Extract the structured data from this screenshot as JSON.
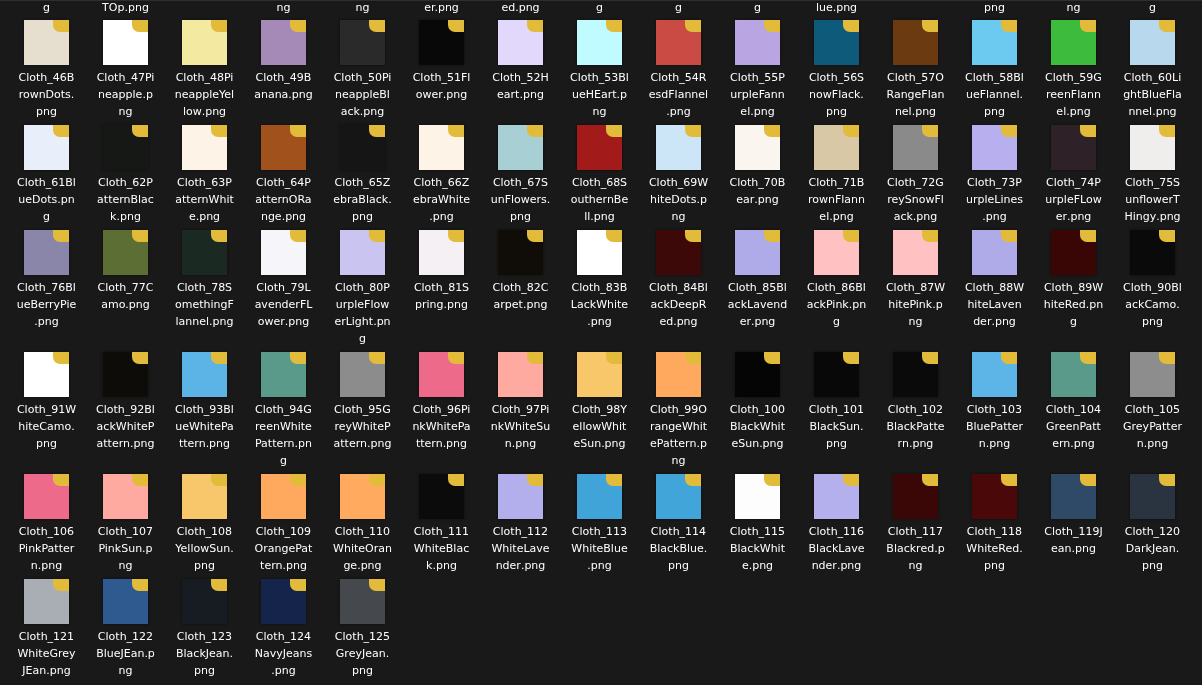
{
  "cut_off_labels": [
    {
      "kind": "text",
      "label": "g"
    },
    {
      "kind": "text",
      "label": "TOp.png"
    },
    {
      "kind": "gap"
    },
    {
      "kind": "text",
      "label": "ng"
    },
    {
      "kind": "text",
      "label": "ng"
    },
    {
      "kind": "text",
      "label": "er.png"
    },
    {
      "kind": "text",
      "label": "ed.png"
    },
    {
      "kind": "text",
      "label": "g"
    },
    {
      "kind": "text",
      "label": "g"
    },
    {
      "kind": "text",
      "label": "g"
    },
    {
      "kind": "text",
      "label": "lue.png"
    },
    {
      "kind": "gap"
    },
    {
      "kind": "text",
      "label": "png"
    },
    {
      "kind": "text",
      "label": "ng"
    },
    {
      "kind": "text",
      "label": "g"
    }
  ],
  "files": [
    {
      "name": "Cloth_46BrownDots.png",
      "color": "#e6dfd0"
    },
    {
      "name": "Cloth_47Pineapple.png",
      "color": "#ffffff"
    },
    {
      "name": "Cloth_48PineappleYellow.png",
      "color": "#f3e9a0"
    },
    {
      "name": "Cloth_49Banana.png",
      "color": "#a58ab8"
    },
    {
      "name": "Cloth_50PineappleBlack.png",
      "color": "#2a2a2a"
    },
    {
      "name": "Cloth_51Flower.png",
      "color": "#080808"
    },
    {
      "name": "Cloth_52Heart.png",
      "color": "#e2d8fb"
    },
    {
      "name": "Cloth_53BlueHEart.png",
      "color": "#bffbff"
    },
    {
      "name": "Cloth_54ResdFlannel.png",
      "color": "#c94b43"
    },
    {
      "name": "Cloth_55PurpleFannel.png",
      "color": "#b9a5e2"
    },
    {
      "name": "Cloth_56SnowFlack.png",
      "color": "#0d5a7a"
    },
    {
      "name": "Cloth_57ORangeFlannel.png",
      "color": "#6b3a10"
    },
    {
      "name": "Cloth_58BlueFlannel.png",
      "color": "#6ccaf0"
    },
    {
      "name": "Cloth_59GreenFlannel.png",
      "color": "#3dbb3d"
    },
    {
      "name": "Cloth_60LightBlueFlannel.png",
      "color": "#b8d8ee"
    },
    {
      "name": "Cloth_61BlueDots.png",
      "color": "#e8eefa"
    },
    {
      "name": "Cloth_62PatternBlack.png",
      "color": "#161816"
    },
    {
      "name": "Cloth_63PatternWhite.png",
      "color": "#fdf3e6"
    },
    {
      "name": "Cloth_64PatternORange.png",
      "color": "#a1521c"
    },
    {
      "name": "Cloth_65ZebraBlack.png",
      "color": "#151515"
    },
    {
      "name": "Cloth_66ZebraWhite.png",
      "color": "#fdf3e6"
    },
    {
      "name": "Cloth_67SunFlowers.png",
      "color": "#a8cfd4"
    },
    {
      "name": "Cloth_68SouthernBell.png",
      "color": "#a31a1a"
    },
    {
      "name": "Cloth_69WhiteDots.png",
      "color": "#cce6f7"
    },
    {
      "name": "Cloth_70Bear.png",
      "color": "#fbf5f0"
    },
    {
      "name": "Cloth_71BrownFlannel.png",
      "color": "#d8c8a6"
    },
    {
      "name": "Cloth_72GreySnowFlack.png",
      "color": "#8a8a8a"
    },
    {
      "name": "Cloth_73PurpleLines.png",
      "color": "#b8b0ee"
    },
    {
      "name": "Cloth_74PurpleFLower.png",
      "color": "#2e2228"
    },
    {
      "name": "Cloth_75SunflowerTHingy.png",
      "color": "#f0eeec"
    },
    {
      "name": "Cloth_76BlueBerryPie.png",
      "color": "#8a86aa"
    },
    {
      "name": "Cloth_77Camo.png",
      "color": "#5c6e34"
    },
    {
      "name": "Cloth_78SomethingFlannel.png",
      "color": "#1a2a22"
    },
    {
      "name": "Cloth_79LavenderFLower.png",
      "color": "#f5f5fa"
    },
    {
      "name": "Cloth_80PurpleFlowerLight.png",
      "color": "#c9c4f0"
    },
    {
      "name": "Cloth_81Spring.png",
      "color": "#f4f0f4"
    },
    {
      "name": "Cloth_82Carpet.png",
      "color": "#100c08"
    },
    {
      "name": "Cloth_83BLackWhite.png",
      "color": "#ffffff"
    },
    {
      "name": "Cloth_84BlackDeepRed.png",
      "color": "#3d0808"
    },
    {
      "name": "Cloth_85BlackLavender.png",
      "color": "#afaae8"
    },
    {
      "name": "Cloth_86BlackPink.png",
      "color": "#ffc1c1"
    },
    {
      "name": "Cloth_87WhitePink.png",
      "color": "#ffc1c1"
    },
    {
      "name": "Cloth_88WhiteLavender.png",
      "color": "#afaae8"
    },
    {
      "name": "Cloth_89WhiteRed.png",
      "color": "#3a0505"
    },
    {
      "name": "Cloth_90BlackCamo.png",
      "color": "#0a0a0a"
    },
    {
      "name": "Cloth_91WhiteCamo.png",
      "color": "#ffffff"
    },
    {
      "name": "Cloth_92BlackWhitePattern.png",
      "color": "#0e0c08"
    },
    {
      "name": "Cloth_93BlueWhitePattern.png",
      "color": "#5cb3e6"
    },
    {
      "name": "Cloth_94GreenWhitePattern.png",
      "color": "#5a9a8a"
    },
    {
      "name": "Cloth_95GreyWhitePattern.png",
      "color": "#8c8c8c"
    },
    {
      "name": "Cloth_96PinkWhitePattern.png",
      "color": "#ed6a8a"
    },
    {
      "name": "Cloth_97PinkWhiteSun.png",
      "color": "#ffaaa0"
    },
    {
      "name": "Cloth_98YellowWhiteSun.png",
      "color": "#f8c76a"
    },
    {
      "name": "Cloth_99OrangeWhitePattern.png",
      "color": "#ffa95e"
    },
    {
      "name": "Cloth_100BlackWhiteSun.png",
      "color": "#050505"
    },
    {
      "name": "Cloth_101BlackSun.png",
      "color": "#080808"
    },
    {
      "name": "Cloth_102BlackPattern.png",
      "color": "#0a0a0a"
    },
    {
      "name": "Cloth_103BluePattern.png",
      "color": "#5cb4e7"
    },
    {
      "name": "Cloth_104GreenPattern.png",
      "color": "#5a9a8b"
    },
    {
      "name": "Cloth_105GreyPattern.png",
      "color": "#8d8d8d"
    },
    {
      "name": "Cloth_106PinkPattern.png",
      "color": "#ed6a8b"
    },
    {
      "name": "Cloth_107PinkSun.png",
      "color": "#ffaaa1"
    },
    {
      "name": "Cloth_108YellowSun.png",
      "color": "#f8c76b"
    },
    {
      "name": "Cloth_109OrangePattern.png",
      "color": "#ffa95f"
    },
    {
      "name": "Cloth_110WhiteOrange.png",
      "color": "#ffaa5e"
    },
    {
      "name": "Cloth_111WhiteBlack.png",
      "color": "#0b0b0b"
    },
    {
      "name": "Cloth_112WhiteLavender.png",
      "color": "#b3aeec"
    },
    {
      "name": "Cloth_113WhiteBlue.png",
      "color": "#40a4d8"
    },
    {
      "name": "Cloth_114BlackBlue.png",
      "color": "#41a5d9"
    },
    {
      "name": "Cloth_115BlackWhite.png",
      "color": "#fdfdfd"
    },
    {
      "name": "Cloth_116BlackLavender.png",
      "color": "#b4afed"
    },
    {
      "name": "Cloth_117Blackred.png",
      "color": "#3b0606"
    },
    {
      "name": "Cloth_118WhiteRed.png",
      "color": "#4a0808"
    },
    {
      "name": "Cloth_119Jean.png",
      "color": "#2f4a66"
    },
    {
      "name": "Cloth_120DarkJean.png",
      "color": "#2a3440"
    },
    {
      "name": "Cloth_121WhiteGreyJEan.png",
      "color": "#a8aeb4"
    },
    {
      "name": "Cloth_122BlueJEan.png",
      "color": "#2e5a90"
    },
    {
      "name": "Cloth_123BlackJean.png",
      "color": "#161c22"
    },
    {
      "name": "Cloth_124NavyJeans.png",
      "color": "#14244a"
    },
    {
      "name": "Cloth_125GreyJean.png",
      "color": "#45484c"
    }
  ]
}
